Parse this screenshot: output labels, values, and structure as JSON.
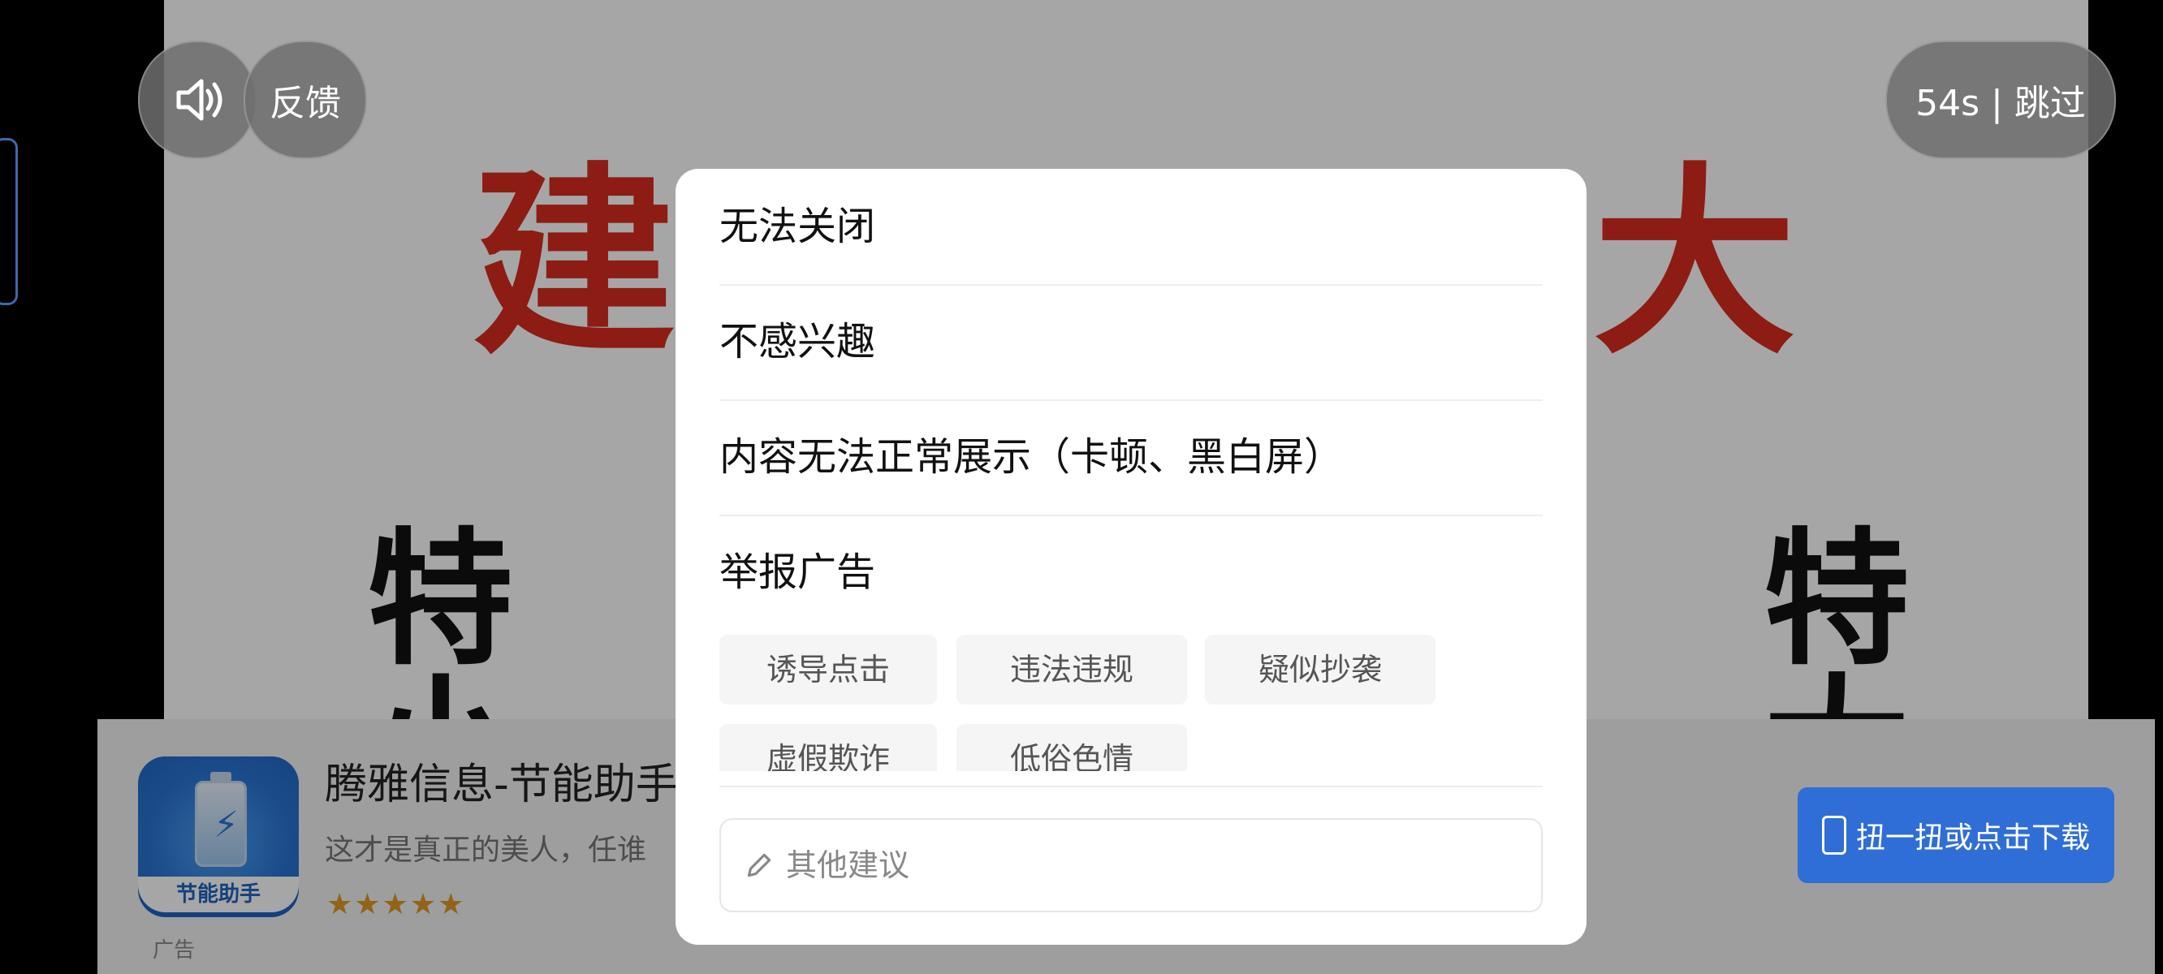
{
  "background": {
    "headline_chars": [
      "建",
      "大"
    ],
    "side_chars": [
      "特",
      "小",
      "特",
      "大"
    ]
  },
  "top_controls": {
    "feedback_label": "反馈",
    "skip_label": "54s | 跳过"
  },
  "ad": {
    "title": "腾雅信息-节能助手",
    "description": "这才是真正的美人，任谁",
    "icon_text": "节能助手",
    "stars": "★★★★★",
    "ad_tag": "广告",
    "download_label": "扭一扭或点击下载"
  },
  "modal": {
    "items": [
      {
        "label": "无法关闭"
      },
      {
        "label": "不感兴趣"
      },
      {
        "label": "内容无法正常展示（卡顿、黑白屏）"
      },
      {
        "label": "举报广告"
      }
    ],
    "report_tags": [
      {
        "label": "诱导点击"
      },
      {
        "label": "违法违规"
      },
      {
        "label": "疑似抄袭"
      },
      {
        "label": "虚假欺诈"
      },
      {
        "label": "低俗色情"
      }
    ],
    "suggestion_placeholder": "其他建议"
  },
  "colors": {
    "accent_blue": "#2f6ed6",
    "headline_red": "#d92b1f",
    "star_orange": "#e09a26"
  }
}
